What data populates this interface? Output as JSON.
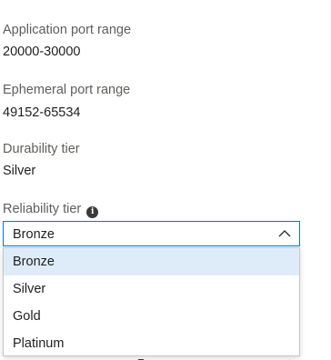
{
  "fields": [
    {
      "label": "Application port range",
      "value": "20000-30000"
    },
    {
      "label": "Ephemeral port range",
      "value": "49152-65534"
    },
    {
      "label": "Durability tier",
      "value": "Silver"
    }
  ],
  "reliability": {
    "label": "Reliability tier",
    "info_icon": "info-icon",
    "selected": "Bronze",
    "options": [
      "Bronze",
      "Silver",
      "Gold",
      "Platinum"
    ]
  },
  "colors": {
    "accent": "#0078d4",
    "selected_option_bg": "#deecf9",
    "label_text": "#605e5c"
  }
}
